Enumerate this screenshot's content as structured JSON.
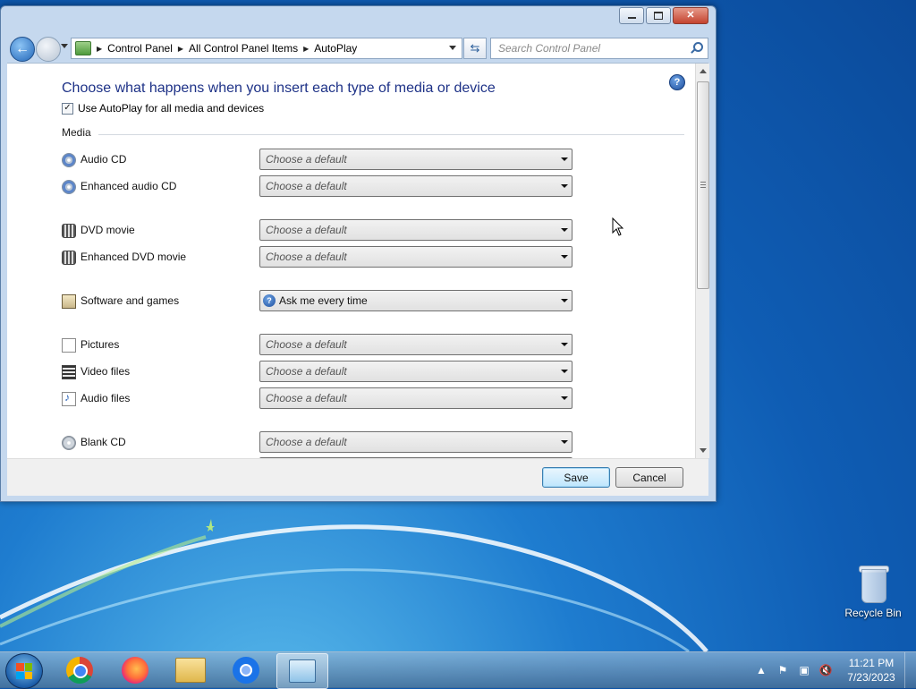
{
  "window": {
    "address": {
      "crumbs": [
        "Control Panel",
        "All Control Panel Items",
        "AutoPlay"
      ],
      "arrow": "▶"
    },
    "search": {
      "placeholder": "Search Control Panel"
    },
    "heading": "Choose what happens when you insert each type of media or device",
    "autoplay_checkbox": {
      "label": "Use AutoPlay for all media and devices",
      "checked": true,
      "mark": "✓"
    },
    "section_label": "Media",
    "media": [
      {
        "label": "Audio CD",
        "icon": "audio-cd-icon",
        "value": "Choose a default",
        "is_default": false
      },
      {
        "label": "Enhanced audio CD",
        "icon": "audio-cd-icon",
        "value": "Choose a default",
        "is_default": false
      },
      {
        "label": "DVD movie",
        "icon": "dvd-icon",
        "value": "Choose a default",
        "is_default": false
      },
      {
        "label": "Enhanced DVD movie",
        "icon": "dvd-icon",
        "value": "Choose a default",
        "is_default": false
      },
      {
        "label": "Software and games",
        "icon": "software-icon",
        "value": "Ask me every time",
        "is_default": true
      },
      {
        "label": "Pictures",
        "icon": "pictures-icon",
        "value": "Choose a default",
        "is_default": false
      },
      {
        "label": "Video files",
        "icon": "video-files-icon",
        "value": "Choose a default",
        "is_default": false
      },
      {
        "label": "Audio files",
        "icon": "audio-files-icon",
        "value": "Choose a default",
        "is_default": false
      },
      {
        "label": "Blank CD",
        "icon": "blank-cd-icon",
        "value": "Choose a default",
        "is_default": false
      }
    ],
    "buttons": {
      "save": "Save",
      "cancel": "Cancel"
    }
  },
  "desktop": {
    "recycle_bin": "Recycle Bin"
  },
  "taskbar": {
    "apps": [
      "chrome-icon",
      "firefox-icon",
      "file-explorer-icon",
      "chromium-icon",
      "control-panel-icon"
    ],
    "clock": {
      "time": "11:21 PM",
      "date": "7/23/2023"
    }
  },
  "colors": {
    "heading": "#1e3287",
    "desktop": "#1e7ccf",
    "primary_button": "#bee6fd"
  }
}
